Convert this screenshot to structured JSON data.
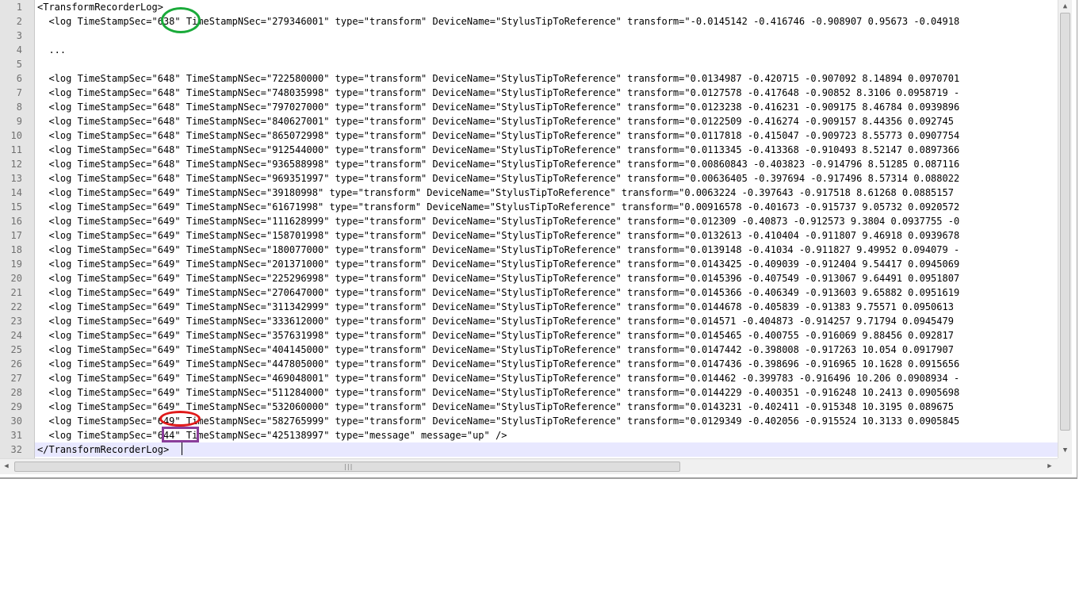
{
  "editor": {
    "lines": [
      {
        "n": "1",
        "text": "<TransformRecorderLog>"
      },
      {
        "n": "2",
        "text": "  <log TimeStampSec=\"638\" TimeStampNSec=\"279346001\" type=\"transform\" DeviceName=\"StylusTipToReference\" transform=\"-0.0145142 -0.416746 -0.908907 0.95673 -0.04918"
      },
      {
        "n": "3",
        "text": ""
      },
      {
        "n": "4",
        "text": "  ..."
      },
      {
        "n": "5",
        "text": ""
      },
      {
        "n": "6",
        "text": "  <log TimeStampSec=\"648\" TimeStampNSec=\"722580000\" type=\"transform\" DeviceName=\"StylusTipToReference\" transform=\"0.0134987 -0.420715 -0.907092 8.14894 0.0970701"
      },
      {
        "n": "7",
        "text": "  <log TimeStampSec=\"648\" TimeStampNSec=\"748035998\" type=\"transform\" DeviceName=\"StylusTipToReference\" transform=\"0.0127578 -0.417648 -0.90852 8.3106 0.0958719 -"
      },
      {
        "n": "8",
        "text": "  <log TimeStampSec=\"648\" TimeStampNSec=\"797027000\" type=\"transform\" DeviceName=\"StylusTipToReference\" transform=\"0.0123238 -0.416231 -0.909175 8.46784 0.0939896"
      },
      {
        "n": "9",
        "text": "  <log TimeStampSec=\"648\" TimeStampNSec=\"840627001\" type=\"transform\" DeviceName=\"StylusTipToReference\" transform=\"0.0122509 -0.416274 -0.909157 8.44356 0.092745"
      },
      {
        "n": "10",
        "text": "  <log TimeStampSec=\"648\" TimeStampNSec=\"865072998\" type=\"transform\" DeviceName=\"StylusTipToReference\" transform=\"0.0117818 -0.415047 -0.909723 8.55773 0.0907754"
      },
      {
        "n": "11",
        "text": "  <log TimeStampSec=\"648\" TimeStampNSec=\"912544000\" type=\"transform\" DeviceName=\"StylusTipToReference\" transform=\"0.0113345 -0.413368 -0.910493 8.52147 0.0897366"
      },
      {
        "n": "12",
        "text": "  <log TimeStampSec=\"648\" TimeStampNSec=\"936588998\" type=\"transform\" DeviceName=\"StylusTipToReference\" transform=\"0.00860843 -0.403823 -0.914796 8.51285 0.087116"
      },
      {
        "n": "13",
        "text": "  <log TimeStampSec=\"648\" TimeStampNSec=\"969351997\" type=\"transform\" DeviceName=\"StylusTipToReference\" transform=\"0.00636405 -0.397694 -0.917496 8.57314 0.088022"
      },
      {
        "n": "14",
        "text": "  <log TimeStampSec=\"649\" TimeStampNSec=\"39180998\" type=\"transform\" DeviceName=\"StylusTipToReference\" transform=\"0.0063224 -0.397643 -0.917518 8.61268 0.0885157"
      },
      {
        "n": "15",
        "text": "  <log TimeStampSec=\"649\" TimeStampNSec=\"61671998\" type=\"transform\" DeviceName=\"StylusTipToReference\" transform=\"0.00916578 -0.401673 -0.915737 9.05732 0.0920572"
      },
      {
        "n": "16",
        "text": "  <log TimeStampSec=\"649\" TimeStampNSec=\"111628999\" type=\"transform\" DeviceName=\"StylusTipToReference\" transform=\"0.012309 -0.40873 -0.912573 9.3804 0.0937755 -0"
      },
      {
        "n": "17",
        "text": "  <log TimeStampSec=\"649\" TimeStampNSec=\"158701998\" type=\"transform\" DeviceName=\"StylusTipToReference\" transform=\"0.0132613 -0.410404 -0.911807 9.46918 0.0939678"
      },
      {
        "n": "18",
        "text": "  <log TimeStampSec=\"649\" TimeStampNSec=\"180077000\" type=\"transform\" DeviceName=\"StylusTipToReference\" transform=\"0.0139148 -0.41034 -0.911827 9.49952 0.094079 -"
      },
      {
        "n": "19",
        "text": "  <log TimeStampSec=\"649\" TimeStampNSec=\"201371000\" type=\"transform\" DeviceName=\"StylusTipToReference\" transform=\"0.0143425 -0.409039 -0.912404 9.54417 0.0945069"
      },
      {
        "n": "20",
        "text": "  <log TimeStampSec=\"649\" TimeStampNSec=\"225296998\" type=\"transform\" DeviceName=\"StylusTipToReference\" transform=\"0.0145396 -0.407549 -0.913067 9.64491 0.0951807"
      },
      {
        "n": "21",
        "text": "  <log TimeStampSec=\"649\" TimeStampNSec=\"270647000\" type=\"transform\" DeviceName=\"StylusTipToReference\" transform=\"0.0145366 -0.406349 -0.913603 9.65882 0.0951619"
      },
      {
        "n": "22",
        "text": "  <log TimeStampSec=\"649\" TimeStampNSec=\"311342999\" type=\"transform\" DeviceName=\"StylusTipToReference\" transform=\"0.0144678 -0.405839 -0.91383 9.75571 0.0950613"
      },
      {
        "n": "23",
        "text": "  <log TimeStampSec=\"649\" TimeStampNSec=\"333612000\" type=\"transform\" DeviceName=\"StylusTipToReference\" transform=\"0.014571 -0.404873 -0.914257 9.71794 0.0945479"
      },
      {
        "n": "24",
        "text": "  <log TimeStampSec=\"649\" TimeStampNSec=\"357631998\" type=\"transform\" DeviceName=\"StylusTipToReference\" transform=\"0.0145465 -0.400755 -0.916069 9.88456 0.092817"
      },
      {
        "n": "25",
        "text": "  <log TimeStampSec=\"649\" TimeStampNSec=\"404145000\" type=\"transform\" DeviceName=\"StylusTipToReference\" transform=\"0.0147442 -0.398008 -0.917263 10.054 0.0917907"
      },
      {
        "n": "26",
        "text": "  <log TimeStampSec=\"649\" TimeStampNSec=\"447805000\" type=\"transform\" DeviceName=\"StylusTipToReference\" transform=\"0.0147436 -0.398696 -0.916965 10.1628 0.0915656"
      },
      {
        "n": "27",
        "text": "  <log TimeStampSec=\"649\" TimeStampNSec=\"469048001\" type=\"transform\" DeviceName=\"StylusTipToReference\" transform=\"0.014462 -0.399783 -0.916496 10.206 0.0908934 -"
      },
      {
        "n": "28",
        "text": "  <log TimeStampSec=\"649\" TimeStampNSec=\"511284000\" type=\"transform\" DeviceName=\"StylusTipToReference\" transform=\"0.0144229 -0.400351 -0.916248 10.2413 0.0905698"
      },
      {
        "n": "29",
        "text": "  <log TimeStampSec=\"649\" TimeStampNSec=\"532060000\" type=\"transform\" DeviceName=\"StylusTipToReference\" transform=\"0.0143231 -0.402411 -0.915348 10.3195 0.089675"
      },
      {
        "n": "30",
        "text": "  <log TimeStampSec=\"649\" TimeStampNSec=\"582765999\" type=\"transform\" DeviceName=\"StylusTipToReference\" transform=\"0.0129349 -0.402056 -0.915524 10.3133 0.0905845"
      },
      {
        "n": "31",
        "text": "  <log TimeStampSec=\"644\" TimeStampNSec=\"425138997\" type=\"message\" message=\"up\" />"
      },
      {
        "n": "32",
        "text": "</TransformRecorderLog>"
      }
    ],
    "current_line": 32
  },
  "scrollbars": {
    "up_arrow": "▲",
    "down_arrow": "▼",
    "left_arrow": "◀",
    "right_arrow": "▶",
    "grip": "|||"
  },
  "highlights": {
    "green": "#1aaa3a",
    "red": "#e01a1a",
    "purple": "#8a3d9a"
  },
  "colors": {
    "gutter_bg": "#e4e4e4",
    "current_line_bg": "#e8e8ff"
  }
}
